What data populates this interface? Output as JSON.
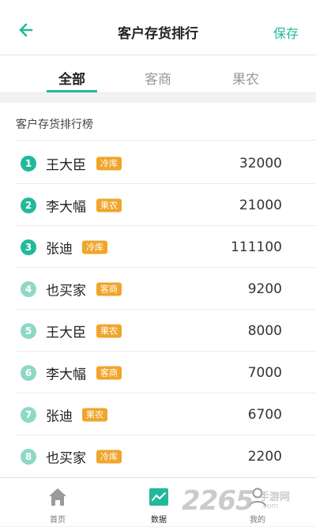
{
  "header": {
    "title": "客户存货排行",
    "save_label": "保存"
  },
  "tabs": [
    {
      "label": "全部",
      "active": true
    },
    {
      "label": "客商",
      "active": false
    },
    {
      "label": "果农",
      "active": false
    }
  ],
  "list": {
    "title": "客户存货排行榜",
    "rows": [
      {
        "rank": "1",
        "name": "王大臣",
        "tag": "冷库",
        "value": "32000"
      },
      {
        "rank": "2",
        "name": "李大幅",
        "tag": "果农",
        "value": "21000"
      },
      {
        "rank": "3",
        "name": "张迪",
        "tag": "冷库",
        "value": "111100"
      },
      {
        "rank": "4",
        "name": "也买家",
        "tag": "客商",
        "value": "9200"
      },
      {
        "rank": "5",
        "name": "王大臣",
        "tag": "果农",
        "value": "8000"
      },
      {
        "rank": "6",
        "name": "李大幅",
        "tag": "客商",
        "value": "7000"
      },
      {
        "rank": "7",
        "name": "张迪",
        "tag": "果农",
        "value": "6700"
      },
      {
        "rank": "8",
        "name": "也买家",
        "tag": "冷库",
        "value": "2200"
      }
    ]
  },
  "bottom_nav": [
    {
      "label": "首页",
      "icon": "home-icon"
    },
    {
      "label": "数据",
      "icon": "chart-icon",
      "active": true
    },
    {
      "label": "我的",
      "icon": "user-icon"
    }
  ],
  "watermark": {
    "number": "2265",
    "text_cn": "手游网",
    "url": ".com"
  },
  "colors": {
    "accent": "#22b99a",
    "rank_top3": "#22b99a",
    "rank_other": "#8ed8c6",
    "badge": "#f0a52b"
  }
}
